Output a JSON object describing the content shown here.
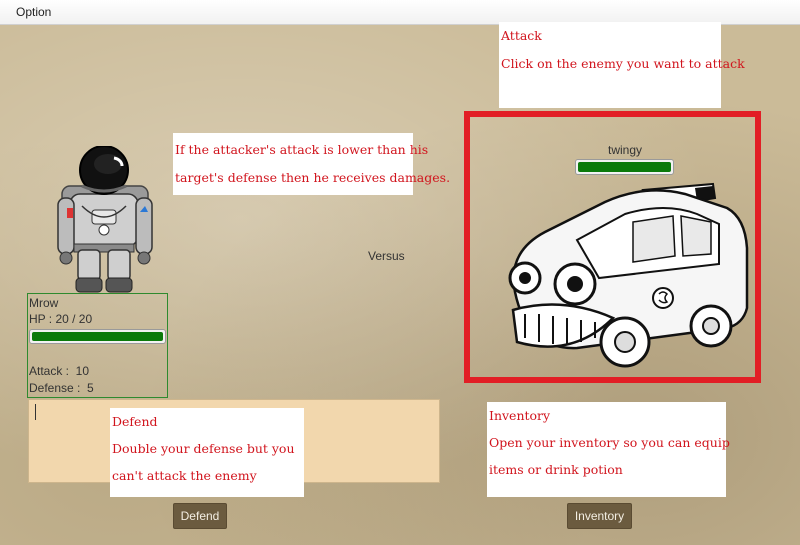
{
  "menu": {
    "option_label": "Option"
  },
  "tooltips": {
    "attack": {
      "title": "Attack",
      "text": "Click on the enemy you want to attack"
    },
    "damage": {
      "line1": "If the attacker's attack is lower than his",
      "line2": "target's defense then he receives damages."
    },
    "defend": {
      "title": "Defend",
      "line1": "Double your defense but you",
      "line2": "can't attack the enemy"
    },
    "inventory": {
      "title": "Inventory",
      "line1": "Open your inventory so you can equip",
      "line2": "items or drink potion"
    }
  },
  "enemy": {
    "name": "twingy",
    "hp_fraction": 1.0
  },
  "versus_label": "Versus",
  "player": {
    "name": "Mrow",
    "hp_text": "HP : 20 / 20",
    "hp_fraction": 1.0,
    "attack_text": "Attack :  10",
    "defense_text": "Defense :  5"
  },
  "buttons": {
    "defend_label": "Defend",
    "inventory_label": "Inventory"
  },
  "colors": {
    "accent_red": "#e21e25",
    "hp_green": "#0b7a0b",
    "tip_text": "#d1141d"
  }
}
